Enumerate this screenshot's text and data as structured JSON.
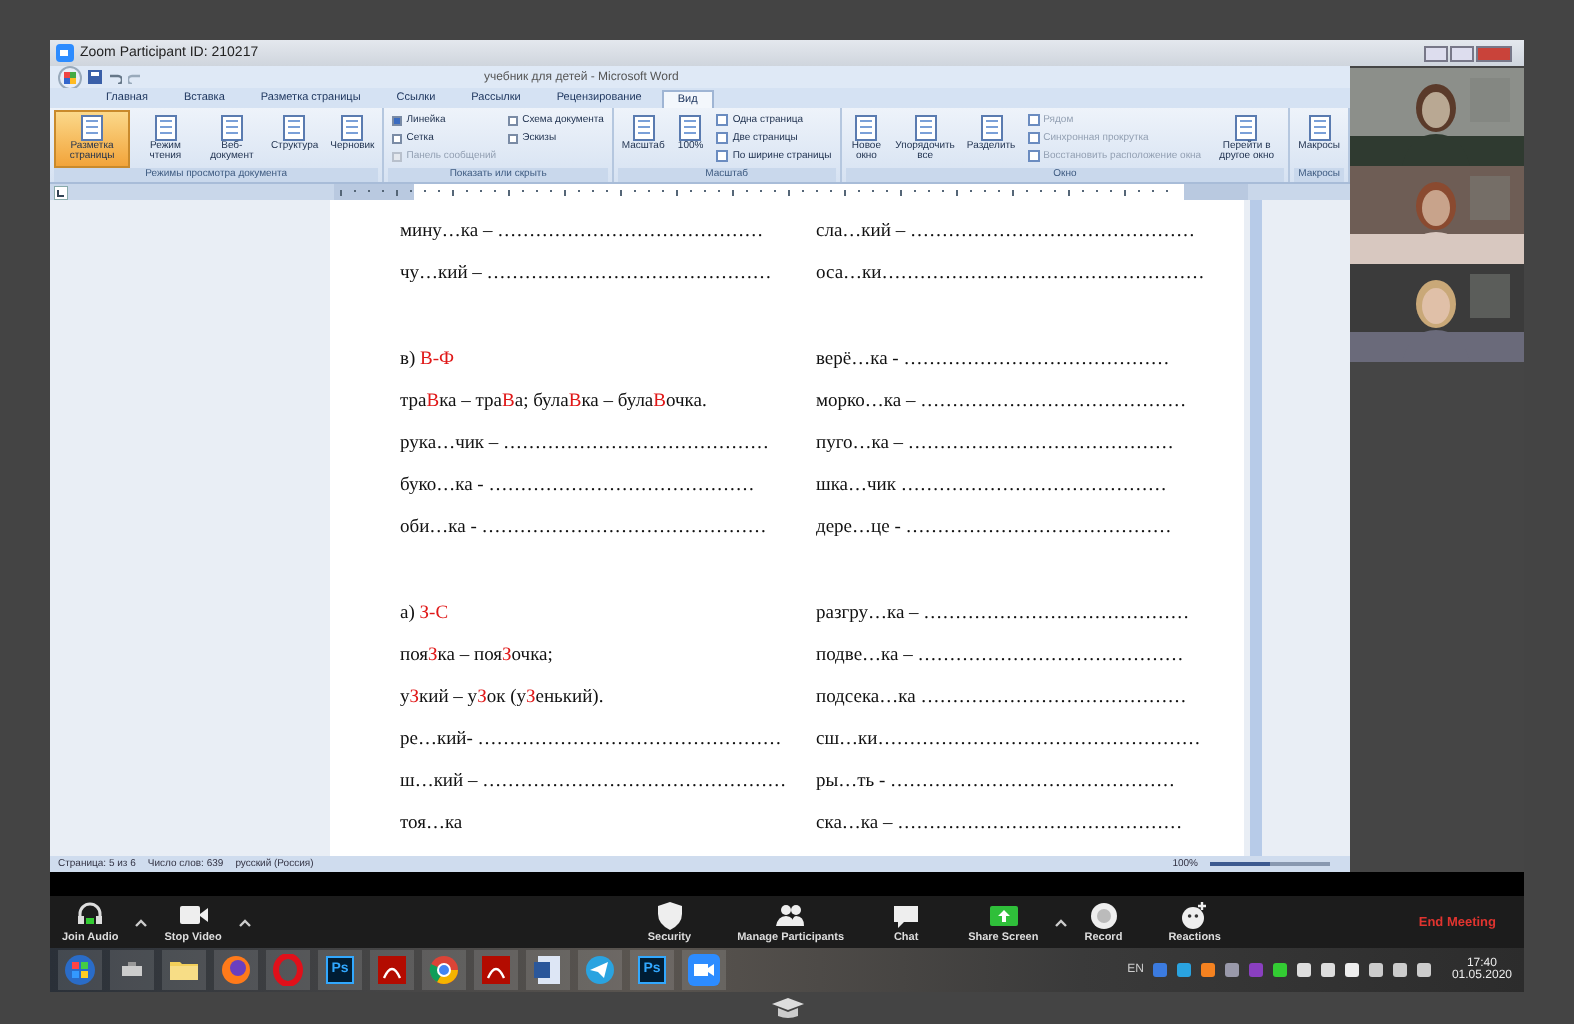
{
  "window": {
    "title": "Zoom Participant ID: 210217"
  },
  "word": {
    "title": "учебник для детей - Microsoft Word",
    "tabs": [
      {
        "label": "Главная",
        "selected": false
      },
      {
        "label": "Вставка",
        "selected": false
      },
      {
        "label": "Разметка страницы",
        "selected": false
      },
      {
        "label": "Ссылки",
        "selected": false
      },
      {
        "label": "Рассылки",
        "selected": false
      },
      {
        "label": "Рецензирование",
        "selected": false
      },
      {
        "label": "Вид",
        "selected": true
      }
    ],
    "ribbon_groups": [
      {
        "label": "Режимы просмотра документа",
        "items": [
          {
            "kind": "large",
            "label": "Разметка страницы",
            "selected": true
          },
          {
            "kind": "large",
            "label": "Режим чтения",
            "selected": false
          },
          {
            "kind": "large",
            "label": "Веб-документ",
            "selected": false
          },
          {
            "kind": "large",
            "label": "Структура",
            "selected": false
          },
          {
            "kind": "large",
            "label": "Черновик",
            "selected": false
          }
        ]
      },
      {
        "label": "Показать или скрыть",
        "items": [
          {
            "kind": "check",
            "label": "Линейка",
            "checked": true,
            "disabled": false
          },
          {
            "kind": "check",
            "label": "Сетка",
            "checked": false,
            "disabled": false
          },
          {
            "kind": "check",
            "label": "Панель сообщений",
            "checked": false,
            "disabled": true
          },
          {
            "kind": "check",
            "label": "Схема документа",
            "checked": false,
            "disabled": false
          },
          {
            "kind": "check",
            "label": "Эскизы",
            "checked": false,
            "disabled": false
          }
        ]
      },
      {
        "label": "Масштаб",
        "items": [
          {
            "kind": "large",
            "label": "Масштаб",
            "selected": false
          },
          {
            "kind": "large",
            "label": "100%",
            "selected": false
          },
          {
            "kind": "small",
            "label": "Одна страница",
            "disabled": false
          },
          {
            "kind": "small",
            "label": "Две страницы",
            "disabled": false
          },
          {
            "kind": "small",
            "label": "По ширине страницы",
            "disabled": false
          }
        ]
      },
      {
        "label": "Окно",
        "items": [
          {
            "kind": "large",
            "label": "Новое окно",
            "selected": false
          },
          {
            "kind": "large",
            "label": "Упорядочить все",
            "selected": false
          },
          {
            "kind": "large",
            "label": "Разделить",
            "selected": false
          },
          {
            "kind": "small",
            "label": "Рядом",
            "disabled": true
          },
          {
            "kind": "small",
            "label": "Синхронная прокрутка",
            "disabled": true
          },
          {
            "kind": "small",
            "label": "Восстановить расположение окна",
            "disabled": true
          },
          {
            "kind": "large",
            "label": "Перейти в другое окно",
            "selected": false
          }
        ]
      },
      {
        "label": "Макросы",
        "items": [
          {
            "kind": "large",
            "label": "Макросы",
            "selected": false
          }
        ]
      }
    ],
    "document": {
      "columns": [
        [
          [
            [
              {
                "text": "мину…ка – ……………………………………",
                "accent": false
              }
            ],
            [
              {
                "text": "чу…кий – ………………………………………",
                "accent": false
              }
            ]
          ],
          [
            [
              {
                "text": "в) ",
                "accent": false
              },
              {
                "text": "В-Ф",
                "accent": true
              }
            ],
            [
              {
                "text": "тра",
                "accent": false
              },
              {
                "text": "В",
                "accent": true
              },
              {
                "text": "ка – тра",
                "accent": false
              },
              {
                "text": "В",
                "accent": true
              },
              {
                "text": "а; була",
                "accent": false
              },
              {
                "text": "В",
                "accent": true
              },
              {
                "text": "ка – була",
                "accent": false
              },
              {
                "text": "В",
                "accent": true
              },
              {
                "text": "очка.",
                "accent": false
              }
            ],
            [
              {
                "text": "рука…чик – ……………………………………",
                "accent": false
              }
            ],
            [
              {
                "text": "буко…ка - ……………………………………",
                "accent": false
              }
            ],
            [
              {
                "text": "оби…ка - ………………………………………",
                "accent": false
              }
            ]
          ],
          [
            [
              {
                "text": "а) ",
                "accent": false
              },
              {
                "text": "З-С",
                "accent": true
              }
            ],
            [
              {
                "text": "поя",
                "accent": false
              },
              {
                "text": "З",
                "accent": true
              },
              {
                "text": "ка – поя",
                "accent": false
              },
              {
                "text": "З",
                "accent": true
              },
              {
                "text": "очка;",
                "accent": false
              }
            ],
            [
              {
                "text": "у",
                "accent": false
              },
              {
                "text": "З",
                "accent": true
              },
              {
                "text": "кий – у",
                "accent": false
              },
              {
                "text": "З",
                "accent": true
              },
              {
                "text": "ок (у",
                "accent": false
              },
              {
                "text": "З",
                "accent": true
              },
              {
                "text": "енький).",
                "accent": false
              }
            ],
            [
              {
                "text": "ре…кий- …………………………………………",
                "accent": false
              }
            ],
            [
              {
                "text": "ш…кий – …………………………………………",
                "accent": false
              }
            ],
            [
              {
                "text": "тоя…ка",
                "accent": false
              }
            ]
          ]
        ],
        [
          [
            [
              {
                "text": "сла…кий – ………………………………………",
                "accent": false
              }
            ],
            [
              {
                "text": "оса…ки……………………………………………",
                "accent": false
              }
            ]
          ],
          [
            [
              {
                "text": "верё…ка - ……………………………………",
                "accent": false
              }
            ],
            [
              {
                "text": "морко…ка – ……………………………………",
                "accent": false
              }
            ],
            [
              {
                "text": "пуго…ка – ……………………………………",
                "accent": false
              }
            ],
            [
              {
                "text": "шка…чик  ……………………………………",
                "accent": false
              }
            ],
            [
              {
                "text": "дере…це - ……………………………………",
                "accent": false
              }
            ]
          ],
          [
            [
              {
                "text": "разгру…ка – ……………………………………",
                "accent": false
              }
            ],
            [
              {
                "text": "подве…ка – ……………………………………",
                "accent": false
              }
            ],
            [
              {
                "text": "подсека…ка   ……………………………………",
                "accent": false
              }
            ],
            [
              {
                "text": "сш…ки……………………………………………",
                "accent": false
              }
            ],
            [
              {
                "text": "ры…ть - ………………………………………",
                "accent": false
              }
            ],
            [
              {
                "text": "ска…ка – ………………………………………",
                "accent": false
              }
            ]
          ]
        ]
      ]
    },
    "status_bar": {
      "items": [
        "Страница: 5 из 6",
        "Число слов: 639",
        "русский (Россия)"
      ],
      "zoom": {
        "reading": "100%",
        "level": 0.5
      }
    }
  },
  "meeting_toolbar": {
    "left": [
      {
        "kind": "audio",
        "label": "Join Audio",
        "caret": true
      },
      {
        "kind": "video",
        "label": "Stop Video",
        "caret": true
      }
    ],
    "center": [
      {
        "kind": "security",
        "label": "Security",
        "caret": false
      },
      {
        "kind": "participants",
        "label": "Manage Participants",
        "caret": false
      },
      {
        "kind": "chat",
        "label": "Chat",
        "caret": false
      },
      {
        "kind": "share",
        "label": "Share Screen",
        "caret": true
      },
      {
        "kind": "record",
        "label": "Record",
        "caret": false
      },
      {
        "kind": "reactions",
        "label": "Reactions",
        "caret": false
      }
    ],
    "end_meeting": "End Meeting"
  },
  "taskbar": {
    "apps": [
      {
        "kind": "start"
      },
      {
        "kind": "app"
      },
      {
        "kind": "folder"
      },
      {
        "kind": "firefox"
      },
      {
        "kind": "opera"
      },
      {
        "kind": "photoshop",
        "label": "Ps"
      },
      {
        "kind": "acrobat"
      },
      {
        "kind": "chrome"
      },
      {
        "kind": "acrobat"
      },
      {
        "kind": "word"
      },
      {
        "kind": "telegram"
      },
      {
        "kind": "photoshop",
        "label": "Ps"
      },
      {
        "kind": "zoom"
      }
    ],
    "language": "EN",
    "time": "17:40",
    "date": "01.05.2020"
  }
}
